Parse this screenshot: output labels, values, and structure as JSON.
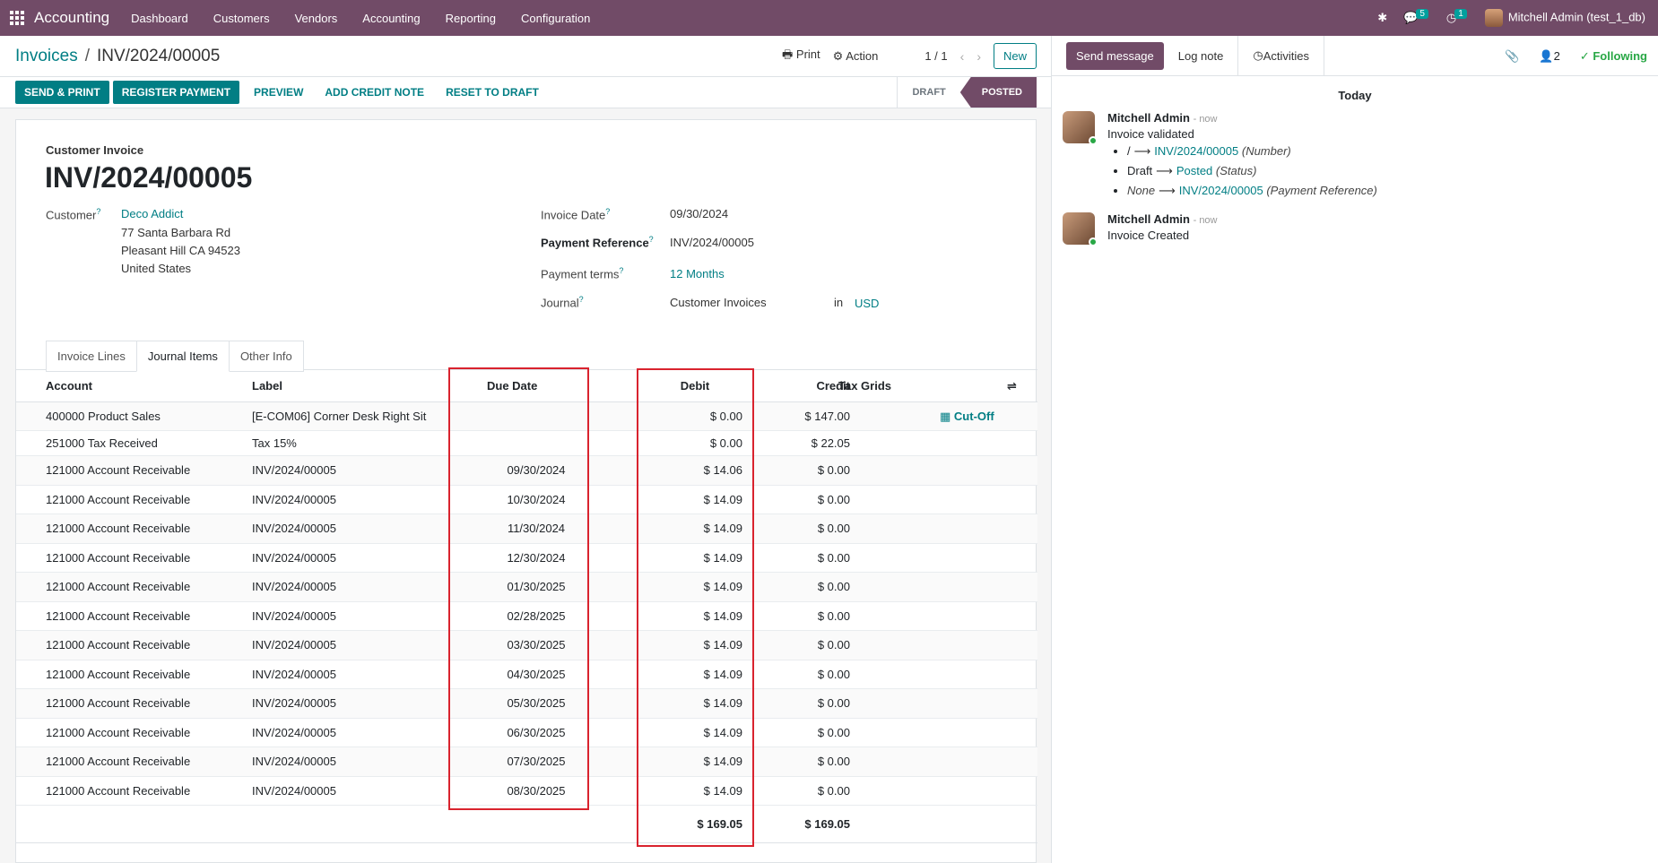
{
  "navbar": {
    "brand": "Accounting",
    "menu": [
      "Dashboard",
      "Customers",
      "Vendors",
      "Accounting",
      "Reporting",
      "Configuration"
    ],
    "chat_badge": "5",
    "activity_badge": "1",
    "user": "Mitchell Admin (test_1_db)"
  },
  "control": {
    "breadcrumb_root": "Invoices",
    "breadcrumb_sep": "/",
    "breadcrumb_current": "INV/2024/00005",
    "print_label": "Print",
    "action_label": "Action",
    "pager": "1 / 1",
    "new_label": "New"
  },
  "actions": {
    "send_print": "SEND & PRINT",
    "register_payment": "REGISTER PAYMENT",
    "preview": "PREVIEW",
    "add_credit_note": "ADD CREDIT NOTE",
    "reset_to_draft": "RESET TO DRAFT",
    "status_draft": "DRAFT",
    "status_posted": "POSTED"
  },
  "invoice": {
    "type": "Customer Invoice",
    "number": "INV/2024/00005",
    "customer_label": "Customer",
    "customer_name": "Deco Addict",
    "address_line1": "77 Santa Barbara Rd",
    "address_line2": "Pleasant Hill CA 94523",
    "address_line3": "United States",
    "invoice_date_label": "Invoice Date",
    "invoice_date": "09/30/2024",
    "payment_ref_label": "Payment Reference",
    "payment_ref": "INV/2024/00005",
    "payment_terms_label": "Payment terms",
    "payment_terms": "12 Months",
    "journal_label": "Journal",
    "journal": "Customer Invoices",
    "journal_in": "in",
    "currency": "USD"
  },
  "tabs": [
    "Invoice Lines",
    "Journal Items",
    "Other Info"
  ],
  "table": {
    "headers": {
      "account": "Account",
      "label": "Label",
      "due_date": "Due Date",
      "debit": "Debit",
      "credit": "Credit",
      "tax_grids": "Tax Grids"
    },
    "cutoff": "Cut-Off",
    "rows": [
      {
        "account": "400000 Product Sales",
        "label": "[E-COM06] Corner Desk Right Sit",
        "due": "",
        "debit": "$ 0.00",
        "credit": "$ 147.00"
      },
      {
        "account": "251000 Tax Received",
        "label": "Tax 15%",
        "due": "",
        "debit": "$ 0.00",
        "credit": "$ 22.05"
      },
      {
        "account": "121000 Account Receivable",
        "label": "INV/2024/00005",
        "due": "09/30/2024",
        "debit": "$ 14.06",
        "credit": "$ 0.00"
      },
      {
        "account": "121000 Account Receivable",
        "label": "INV/2024/00005",
        "due": "10/30/2024",
        "debit": "$ 14.09",
        "credit": "$ 0.00"
      },
      {
        "account": "121000 Account Receivable",
        "label": "INV/2024/00005",
        "due": "11/30/2024",
        "debit": "$ 14.09",
        "credit": "$ 0.00"
      },
      {
        "account": "121000 Account Receivable",
        "label": "INV/2024/00005",
        "due": "12/30/2024",
        "debit": "$ 14.09",
        "credit": "$ 0.00"
      },
      {
        "account": "121000 Account Receivable",
        "label": "INV/2024/00005",
        "due": "01/30/2025",
        "debit": "$ 14.09",
        "credit": "$ 0.00"
      },
      {
        "account": "121000 Account Receivable",
        "label": "INV/2024/00005",
        "due": "02/28/2025",
        "debit": "$ 14.09",
        "credit": "$ 0.00"
      },
      {
        "account": "121000 Account Receivable",
        "label": "INV/2024/00005",
        "due": "03/30/2025",
        "debit": "$ 14.09",
        "credit": "$ 0.00"
      },
      {
        "account": "121000 Account Receivable",
        "label": "INV/2024/00005",
        "due": "04/30/2025",
        "debit": "$ 14.09",
        "credit": "$ 0.00"
      },
      {
        "account": "121000 Account Receivable",
        "label": "INV/2024/00005",
        "due": "05/30/2025",
        "debit": "$ 14.09",
        "credit": "$ 0.00"
      },
      {
        "account": "121000 Account Receivable",
        "label": "INV/2024/00005",
        "due": "06/30/2025",
        "debit": "$ 14.09",
        "credit": "$ 0.00"
      },
      {
        "account": "121000 Account Receivable",
        "label": "INV/2024/00005",
        "due": "07/30/2025",
        "debit": "$ 14.09",
        "credit": "$ 0.00"
      },
      {
        "account": "121000 Account Receivable",
        "label": "INV/2024/00005",
        "due": "08/30/2025",
        "debit": "$ 14.09",
        "credit": "$ 0.00"
      }
    ],
    "total_debit": "$ 169.05",
    "total_credit": "$ 169.05"
  },
  "chatter": {
    "send_message": "Send message",
    "log_note": "Log note",
    "activities": "Activities",
    "followers_count": "2",
    "following": "Following",
    "day": "Today",
    "msg1": {
      "author": "Mitchell Admin",
      "time": "- now",
      "body": "Invoice validated",
      "t1_old": "/",
      "t1_new": "INV/2024/00005",
      "t1_field": "(Number)",
      "t2_old": "Draft",
      "t2_new": "Posted",
      "t2_field": "(Status)",
      "t3_old": "None",
      "t3_new": "INV/2024/00005",
      "t3_field": "(Payment Reference)"
    },
    "msg2": {
      "author": "Mitchell Admin",
      "time": "- now",
      "body": "Invoice Created"
    }
  }
}
